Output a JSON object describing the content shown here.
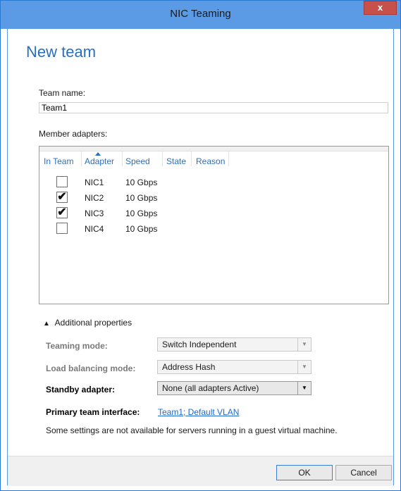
{
  "window": {
    "title": "NIC Teaming",
    "close_label": "x"
  },
  "dialog": {
    "heading": "New team",
    "team_name_label": "Team name:",
    "team_name_value": "Team1",
    "member_adapters_label": "Member adapters:"
  },
  "table": {
    "columns": [
      "In Team",
      "Adapter",
      "Speed",
      "State",
      "Reason"
    ],
    "rows": [
      {
        "checked": false,
        "adapter": "NIC1",
        "speed": "10 Gbps",
        "state": "",
        "reason": ""
      },
      {
        "checked": true,
        "adapter": "NIC2",
        "speed": "10 Gbps",
        "state": "",
        "reason": ""
      },
      {
        "checked": true,
        "adapter": "NIC3",
        "speed": "10 Gbps",
        "state": "",
        "reason": ""
      },
      {
        "checked": false,
        "adapter": "NIC4",
        "speed": "10 Gbps",
        "state": "",
        "reason": ""
      }
    ]
  },
  "additional_properties": {
    "toggle_label": "Additional properties",
    "teaming_mode_label": "Teaming mode:",
    "teaming_mode_value": "Switch Independent",
    "load_balancing_label": "Load balancing mode:",
    "load_balancing_value": "Address Hash",
    "standby_label": "Standby adapter:",
    "standby_value": "None (all adapters Active)",
    "primary_interface_label": "Primary team interface:",
    "primary_interface_link": "Team1; Default VLAN",
    "note": "Some settings are not available for servers running in a guest virtual machine."
  },
  "buttons": {
    "ok": "OK",
    "cancel": "Cancel"
  },
  "icons": {
    "check": "✔",
    "chevron_up": "▲",
    "dropdown": "▼"
  }
}
